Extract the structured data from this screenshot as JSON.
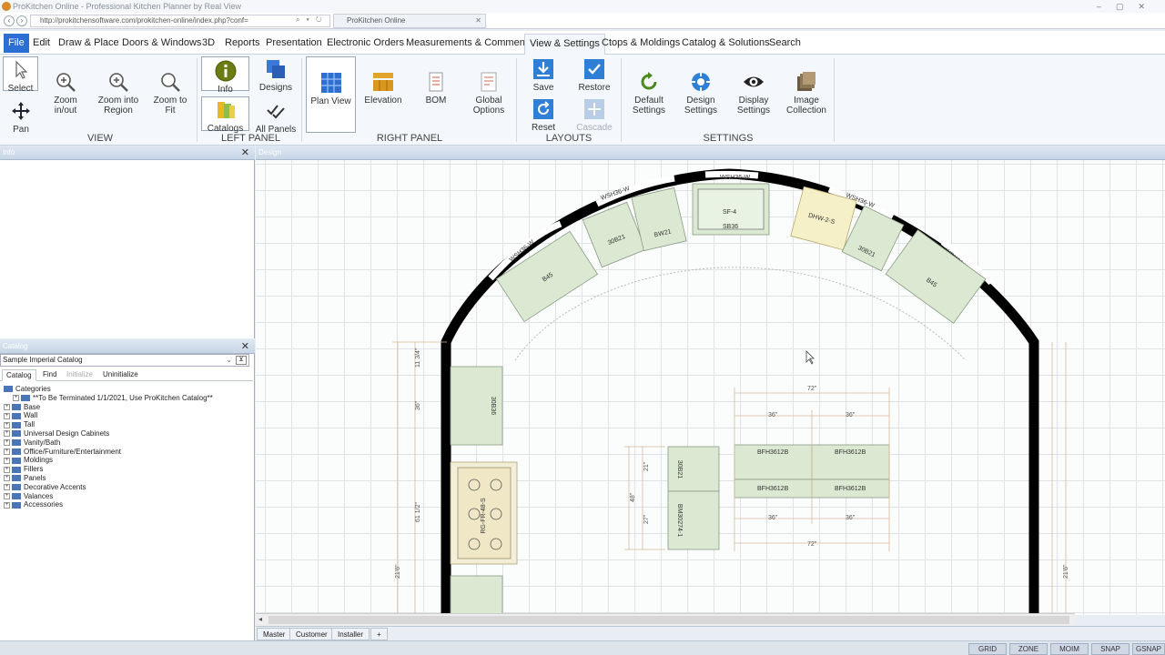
{
  "browser": {
    "title": "ProKitchen Online - Professional Kitchen Planner by Real View",
    "url": "http://prokitchensoftware.com/prokitchen-online/index.php?conf=",
    "tab": "ProKitchen Online"
  },
  "menu": [
    "File",
    "Edit",
    "Draw & Place",
    "Doors & Windows",
    "3D",
    "Reports",
    "Presentation",
    "Electronic Orders",
    "Measurements & Comments",
    "View & Settings",
    "Ctops & Moldings",
    "Catalog & Solutions",
    "Search"
  ],
  "ribbon": {
    "select": "Select",
    "pan": "Pan",
    "zoom_inout": "Zoom in/out",
    "zoom_region": "Zoom into Region",
    "zoom_fit": "Zoom to Fit",
    "info": "Info",
    "designs": "Designs",
    "catalogs": "Catalogs",
    "all_panels": "All Panels",
    "plan_view": "Plan View",
    "elevation": "Elevation",
    "bom": "BOM",
    "global_options": "Global Options",
    "save": "Save",
    "restore": "Restore",
    "reset": "Reset",
    "cascade": "Cascade",
    "default_settings": "Default Settings",
    "design_settings": "Design Settings",
    "display_settings": "Display Settings",
    "image_collection": "Image Collection",
    "groups": {
      "view": "VIEW",
      "left": "LEFT PANEL",
      "right": "RIGHT PANEL",
      "layouts": "LAYOUTS",
      "settings": "SETTINGS"
    }
  },
  "panels": {
    "info": "Info",
    "catalog": "Catalog",
    "design": "Design"
  },
  "catalog": {
    "selected": "Sample Imperial Catalog",
    "tabs": [
      "Catalog",
      "Find",
      "Initialize",
      "Uninitialize"
    ],
    "root": "Categories",
    "items": [
      "**To Be Terminated 1/1/2021, Use ProKitchen Catalog**",
      "Base",
      "Wall",
      "Tall",
      "Universal Design Cabinets",
      "Vanity/Bath",
      "Office/Furniture/Entertainment",
      "Moldings",
      "Fillers",
      "Panels",
      "Decorative Accents",
      "Valances",
      "Accessories"
    ]
  },
  "plan": {
    "wall_labels": [
      "WSH36-W",
      "WSH36-W",
      "WSH36-W",
      "WSH36-W",
      "WSH36-W"
    ],
    "arc_cabinets": [
      "B45",
      "30B21",
      "BW21",
      "DHW-2-S",
      "30B21",
      "B45"
    ],
    "sink": [
      "SF-4",
      "SB36"
    ],
    "left_cabinets": [
      "30B36",
      "RG-FR-48-S"
    ],
    "island": [
      "BFH3612B",
      "BFH3612B",
      "BFH3612B",
      "BFH3612B"
    ],
    "island_side": [
      "30B21",
      "BM30274-1"
    ],
    "dimensions": [
      "72\"",
      "36\"",
      "36\"",
      "36\"",
      "36\"",
      "72\"",
      "21\"",
      "27\"",
      "48\"",
      "11 3/4\"",
      "36\"",
      "61 1/2\"",
      "21'6\"",
      "21'6\""
    ]
  },
  "bottom_tabs": [
    "Master",
    "Customer",
    "Installer",
    "+"
  ],
  "status": [
    "GRID",
    "ZONE",
    "MOIM",
    "SNAP",
    "GSNAP"
  ]
}
